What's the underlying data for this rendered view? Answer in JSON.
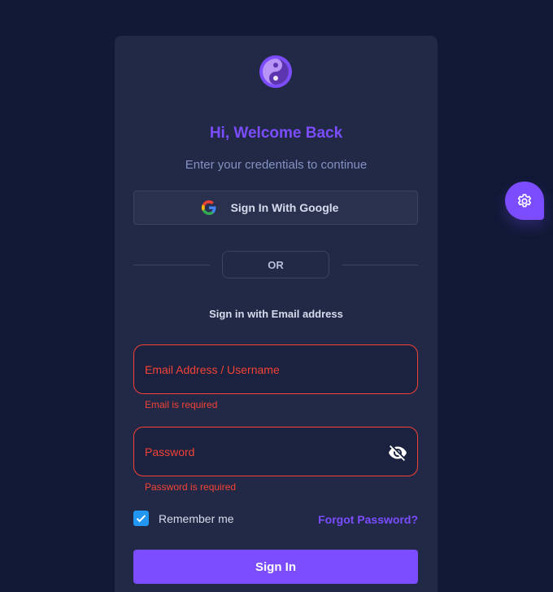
{
  "header": {
    "title": "Hi, Welcome Back",
    "subtitle": "Enter your credentials to continue"
  },
  "google": {
    "label": "Sign In With Google",
    "icon": "google-icon"
  },
  "divider": {
    "label": "OR"
  },
  "email_section": {
    "label": "Sign in with Email address"
  },
  "form": {
    "email": {
      "placeholder": "Email Address / Username",
      "value": "",
      "error": "Email is required"
    },
    "password": {
      "placeholder": "Password",
      "value": "",
      "error": "Password is required",
      "toggle_icon": "eye-off-icon"
    },
    "remember": {
      "label": "Remember me",
      "checked": true
    },
    "forgot_label": "Forgot Password?",
    "submit_label": "Sign In"
  },
  "fab": {
    "icon": "gear-icon"
  },
  "colors": {
    "background": "#111936",
    "card": "#212946",
    "accent": "#7c4dff",
    "error": "#f44336",
    "checkbox": "#2196f3"
  }
}
